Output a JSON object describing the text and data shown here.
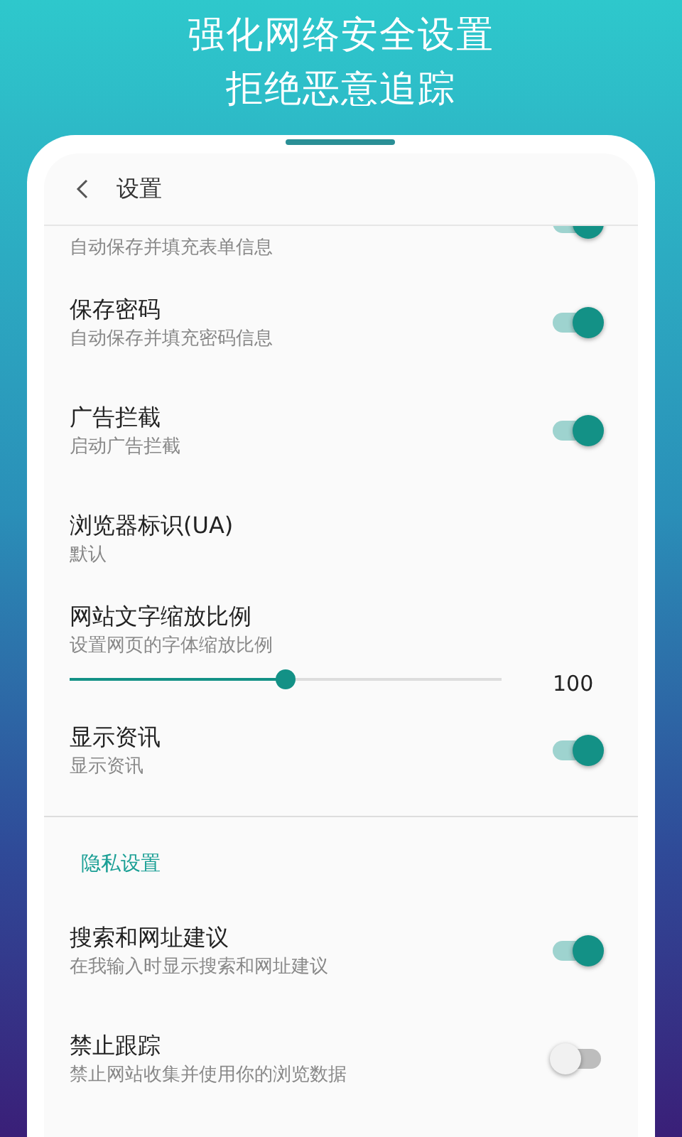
{
  "headline": [
    "强化网络安全设置",
    "拒绝恶意追踪"
  ],
  "header": {
    "title": "设置"
  },
  "groups": [
    {
      "items": [
        {
          "kind": "toggle",
          "subtitle": "自动保存并填充表单信息",
          "on": true,
          "cut": true
        },
        {
          "kind": "toggle",
          "title": "保存密码",
          "subtitle": "自动保存并填充密码信息",
          "on": true
        },
        {
          "kind": "toggle",
          "title": "广告拦截",
          "subtitle": "启动广告拦截",
          "on": true
        },
        {
          "kind": "value",
          "title": "浏览器标识(UA)",
          "subtitle": "默认"
        },
        {
          "kind": "slider",
          "title": "网站文字缩放比例",
          "subtitle": "设置网页的字体缩放比例",
          "level": 0.5,
          "reading": "100"
        },
        {
          "kind": "toggle",
          "title": "显示资讯",
          "subtitle": "显示资讯",
          "on": true
        }
      ]
    },
    {
      "header": "隐私设置",
      "items": [
        {
          "kind": "toggle",
          "title": "搜索和网址建议",
          "subtitle": "在我输入时显示搜索和网址建议",
          "on": true
        },
        {
          "kind": "toggle",
          "title": "禁止跟踪",
          "subtitle": "禁止网站收集并使用你的浏览数据",
          "on": false
        }
      ]
    }
  ]
}
